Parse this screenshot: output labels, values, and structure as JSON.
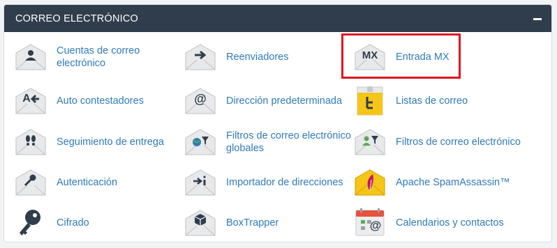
{
  "section": {
    "title": "CORREO ELECTRÓNICO",
    "collapse_icon": "minus-icon"
  },
  "items": [
    {
      "label": "Cuentas de correo electrónico",
      "icon": "user-envelope-icon"
    },
    {
      "label": "Reenviadores",
      "icon": "arrow-right-envelope-icon"
    },
    {
      "label": "Entrada MX",
      "icon": "mx-envelope-icon",
      "glyph": "MX"
    },
    {
      "label": "Auto contestadores",
      "icon": "auto-reply-envelope-icon",
      "glyph": "A"
    },
    {
      "label": "Dirección predeterminada",
      "icon": "at-envelope-icon",
      "glyph": "@"
    },
    {
      "label": "Listas de correo",
      "icon": "mailing-list-icon"
    },
    {
      "label": "Seguimiento de entrega",
      "icon": "footprints-envelope-icon"
    },
    {
      "label": "Filtros de correo electrónico globales",
      "icon": "globe-filter-envelope-icon"
    },
    {
      "label": "Filtros de correo electrónico",
      "icon": "user-filter-envelope-icon"
    },
    {
      "label": "Autenticación",
      "icon": "key-envelope-icon"
    },
    {
      "label": "Importador de direcciones",
      "icon": "import-envelope-icon"
    },
    {
      "label": "Apache SpamAssassin™",
      "icon": "feather-envelope-icon"
    },
    {
      "label": "Cifrado",
      "icon": "key-icon"
    },
    {
      "label": "BoxTrapper",
      "icon": "box-envelope-icon"
    },
    {
      "label": "Calendarios y contactos",
      "icon": "calendar-contacts-icon",
      "glyph": "@"
    }
  ],
  "colors": {
    "header": "#2f3d4c",
    "link": "#2f7bb6",
    "highlight": "#e0141e",
    "accent_yellow": "#f5c518",
    "calendar_red": "#e5533d"
  }
}
